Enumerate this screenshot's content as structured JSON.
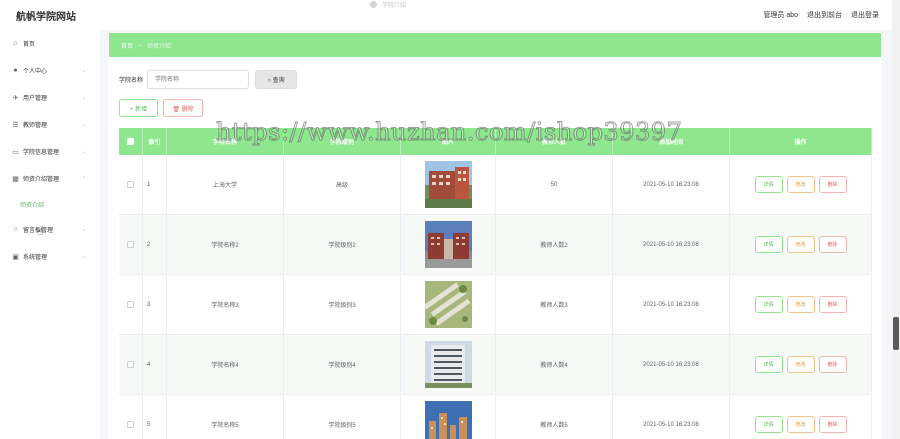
{
  "header": {
    "site_title": "航帆学院网站",
    "center_text": "学院介绍",
    "admin_label": "管理员 abo",
    "back_front_label": "退出到前台",
    "logout_label": "退出登录"
  },
  "sidebar": {
    "items": [
      {
        "label": "首页",
        "icon": "home-icon",
        "glyph": "⌂"
      },
      {
        "label": "个人中心",
        "icon": "user-icon",
        "glyph": "👤"
      },
      {
        "label": "用户管理",
        "icon": "send-icon",
        "glyph": "✈"
      },
      {
        "label": "教师管理",
        "icon": "sliders-icon",
        "glyph": "☰"
      },
      {
        "label": "学院信息管理",
        "icon": "chat-icon",
        "glyph": "▭"
      },
      {
        "label": "师资介绍管理",
        "icon": "grid-icon",
        "glyph": "▦"
      },
      {
        "label": "留言板管理",
        "icon": "circle-icon",
        "glyph": "○"
      },
      {
        "label": "系统管理",
        "icon": "window-icon",
        "glyph": "▣"
      }
    ],
    "active_sub": "师资介绍"
  },
  "breadcrumb": {
    "home": "首页",
    "sep": "→",
    "current": "师资介绍"
  },
  "search": {
    "label": "学院名称",
    "placeholder": "学院名称",
    "button": "○ 查询"
  },
  "actions": {
    "add": "+ 新增",
    "delete": "🗑 删除"
  },
  "table": {
    "headers": [
      "",
      "索引",
      "学院名称",
      "学院级别",
      "图片",
      "教师人数",
      "添加时间",
      "操作"
    ],
    "rows": [
      {
        "index": "1",
        "name": "上海大学",
        "level": "高级",
        "count": "50",
        "time": "2021-05-10 16:23:08"
      },
      {
        "index": "2",
        "name": "学院名称2",
        "level": "学院级别2",
        "count": "教师人数2",
        "time": "2021-05-10 16:23:08"
      },
      {
        "index": "3",
        "name": "学院名称3",
        "level": "学院级别3",
        "count": "教师人数3",
        "time": "2021-05-10 16:23:08"
      },
      {
        "index": "4",
        "name": "学院名称4",
        "level": "学院级别4",
        "count": "教师人数4",
        "time": "2021-05-10 16:23:08"
      },
      {
        "index": "5",
        "name": "学院名称5",
        "level": "学院级别5",
        "count": "教师人数5",
        "time": "2021-05-10 16:23:08"
      }
    ],
    "op_labels": {
      "detail": "详情",
      "edit": "修改",
      "remove": "删除"
    }
  },
  "watermark": "https://www.huzhan.com/ishop39397",
  "colors": {
    "accent": "#8ee68f",
    "accent_text": "#5cb85c",
    "danger": "#e26565",
    "warning": "#e6a23c"
  }
}
